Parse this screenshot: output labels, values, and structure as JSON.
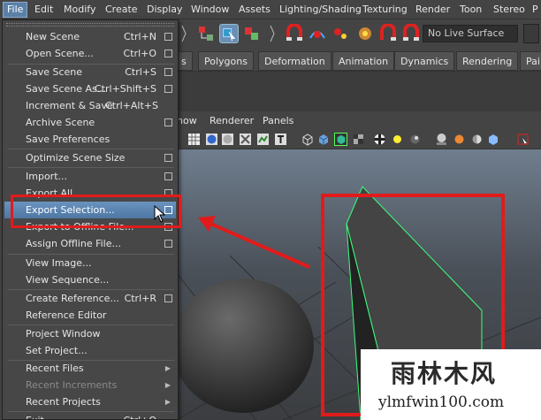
{
  "menubar": {
    "items": [
      "File",
      "Edit",
      "Modify",
      "Create",
      "Display",
      "Window",
      "Assets",
      "Lighting/Shading",
      "Texturing",
      "Render",
      "Toon",
      "Stereo",
      "P"
    ]
  },
  "toolbar": {
    "live_surface": "No Live Surface"
  },
  "shelf": {
    "tabs": [
      "s",
      "Polygons",
      "Deformation",
      "Animation",
      "Dynamics",
      "Rendering",
      "Pai"
    ]
  },
  "panel_menu": {
    "items": [
      "how",
      "Renderer",
      "Panels"
    ]
  },
  "file_menu": {
    "items": [
      {
        "label": "New Scene",
        "shortcut": "Ctrl+N",
        "option": true
      },
      {
        "label": "Open Scene...",
        "shortcut": "Ctrl+O",
        "option": true
      },
      {
        "label": "Save Scene",
        "shortcut": "Ctrl+S",
        "option": true
      },
      {
        "label": "Save Scene As...",
        "shortcut": "Ctrl+Shift+S",
        "option": true
      },
      {
        "label": "Increment & Save",
        "shortcut": "Ctrl+Alt+S",
        "option": true
      },
      {
        "label": "Archive Scene",
        "shortcut": "",
        "option": true
      },
      {
        "label": "Save Preferences",
        "shortcut": "",
        "option": false
      },
      {
        "label": "Optimize Scene Size",
        "shortcut": "",
        "option": true
      },
      {
        "label": "Import...",
        "shortcut": "",
        "option": true
      },
      {
        "label": "Export All...",
        "shortcut": "",
        "option": true
      },
      {
        "label": "Export Selection...",
        "shortcut": "",
        "option": true
      },
      {
        "label": "Export to Offline File...",
        "shortcut": "",
        "option": true
      },
      {
        "label": "Assign Offline File...",
        "shortcut": "",
        "option": true
      },
      {
        "label": "View Image...",
        "shortcut": "",
        "option": false
      },
      {
        "label": "View Sequence...",
        "shortcut": "",
        "option": false
      },
      {
        "label": "Create Reference...",
        "shortcut": "Ctrl+R",
        "option": true
      },
      {
        "label": "Reference Editor",
        "shortcut": "",
        "option": false
      },
      {
        "label": "Project Window",
        "shortcut": "",
        "option": false
      },
      {
        "label": "Set Project...",
        "shortcut": "",
        "option": false
      },
      {
        "label": "Recent Files",
        "shortcut": "",
        "option": false
      },
      {
        "label": "Recent Increments",
        "shortcut": "",
        "option": false
      },
      {
        "label": "Recent Projects",
        "shortcut": "",
        "option": false
      },
      {
        "label": "Exit",
        "shortcut": "Ctrl+Q",
        "option": false
      }
    ]
  },
  "watermark": {
    "title": "雨林木风",
    "url": "ylmfwin100.com"
  },
  "colors": {
    "highlight": "#5a86b4",
    "annotation": "#e11b1b",
    "wireframe": "#3cff7c"
  }
}
